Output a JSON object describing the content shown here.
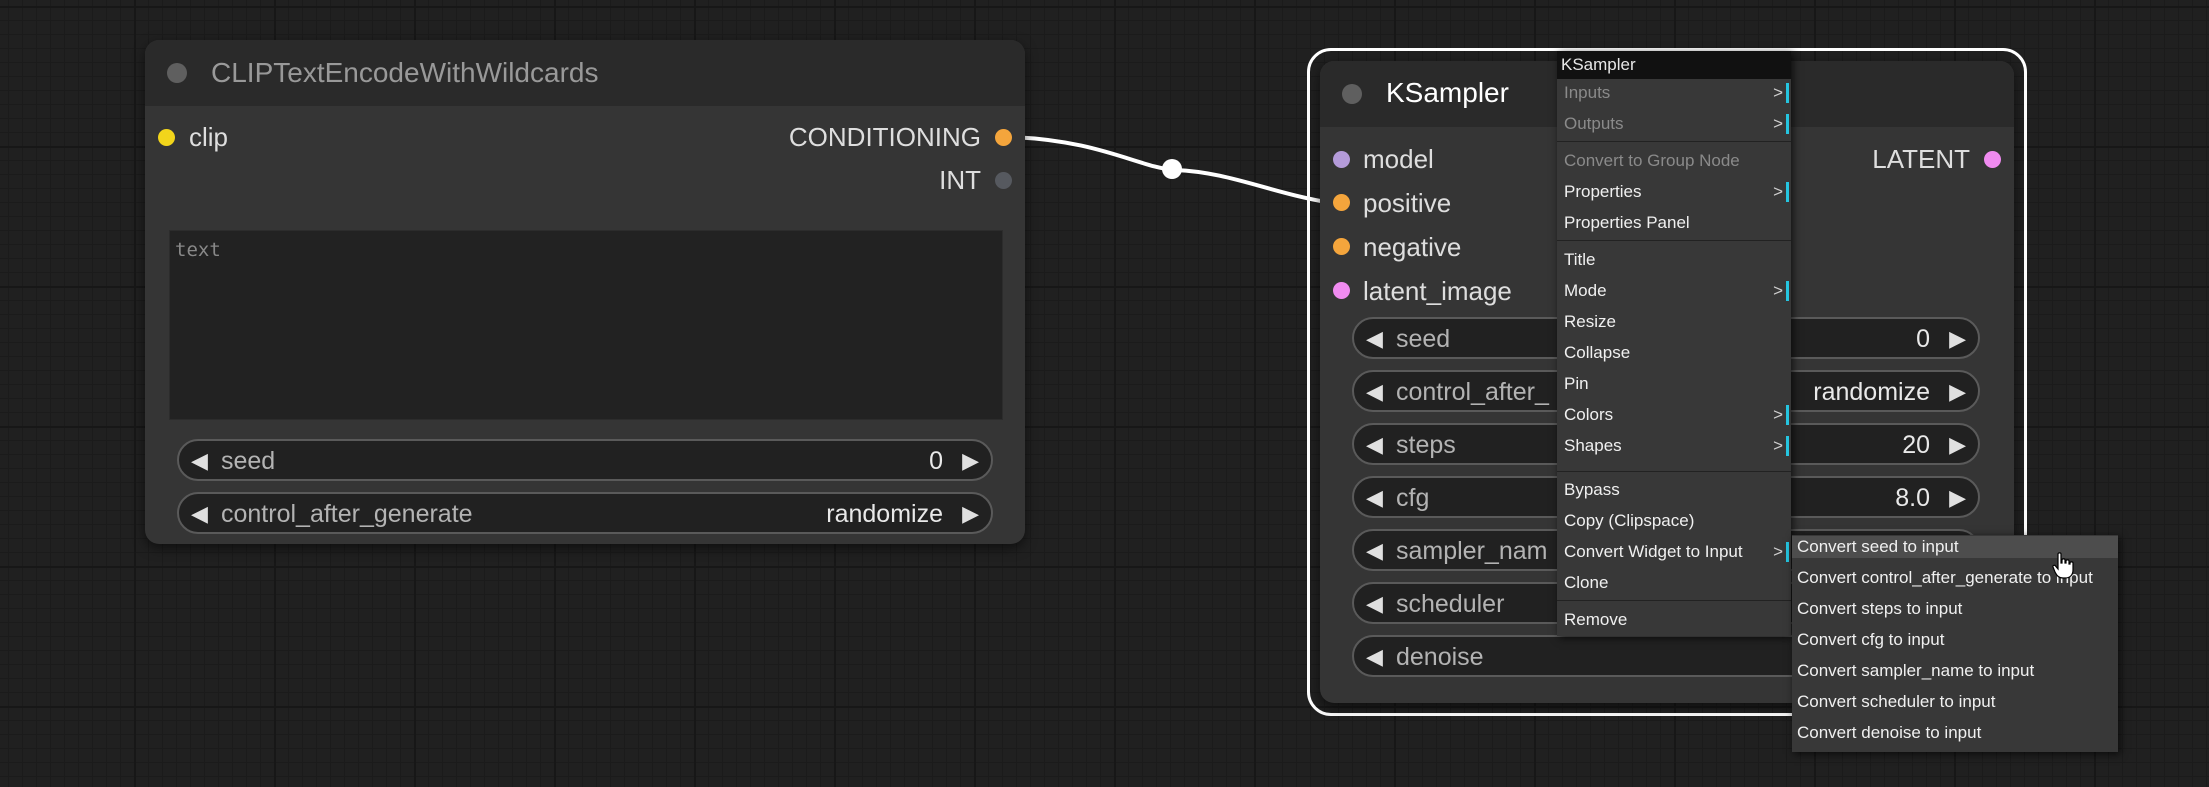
{
  "node_left": {
    "title": "CLIPTextEncodeWithWildcards",
    "inputs": [
      {
        "label": "clip",
        "color": "#f2d51b"
      }
    ],
    "outputs": [
      {
        "label": "CONDITIONING",
        "color": "#f4a53c"
      },
      {
        "label": "INT",
        "color": "#56595f"
      }
    ],
    "text_placeholder": "text",
    "widgets": [
      {
        "label": "seed",
        "value": "0"
      },
      {
        "label": "control_after_generate",
        "value": "randomize"
      }
    ]
  },
  "node_ksampler": {
    "title": "KSampler",
    "inputs": [
      {
        "label": "model",
        "color": "#b49bd9"
      },
      {
        "label": "positive",
        "color": "#f4a53c"
      },
      {
        "label": "negative",
        "color": "#f4a53c"
      },
      {
        "label": "latent_image",
        "color": "#f08bf0"
      }
    ],
    "outputs": [
      {
        "label": "LATENT",
        "color": "#f08bf0"
      }
    ],
    "widgets": [
      {
        "label": "seed",
        "value": "0"
      },
      {
        "label": "control_after_",
        "value": "randomize"
      },
      {
        "label": "steps",
        "value": "20"
      },
      {
        "label": "cfg",
        "value": "8.0"
      },
      {
        "label": "sampler_nam",
        "value": ""
      },
      {
        "label": "scheduler",
        "value": ""
      },
      {
        "label": "denoise",
        "value": ""
      }
    ]
  },
  "context_menu": {
    "title": "KSampler",
    "items": [
      {
        "label": "Inputs",
        "disabled": true,
        "submenu": true
      },
      {
        "label": "Outputs",
        "disabled": true,
        "submenu": true
      },
      {
        "label": "Convert to Group Node",
        "disabled": true
      },
      {
        "label": "Properties",
        "submenu": true
      },
      {
        "label": "Properties Panel"
      },
      {
        "label": "Title"
      },
      {
        "label": "Mode",
        "submenu": true
      },
      {
        "label": "Resize"
      },
      {
        "label": "Collapse"
      },
      {
        "label": "Pin"
      },
      {
        "label": "Colors",
        "submenu": true
      },
      {
        "label": "Shapes",
        "submenu": true
      },
      {
        "label": "Bypass"
      },
      {
        "label": "Copy (Clipspace)"
      },
      {
        "label": "Convert Widget to Input",
        "submenu": true
      },
      {
        "label": "Clone"
      },
      {
        "label": "Remove"
      }
    ],
    "submenu_arrow": ">"
  },
  "submenu": {
    "items": [
      {
        "label": "Convert seed to input",
        "highlighted": true
      },
      {
        "label": "Convert control_after_generate to input"
      },
      {
        "label": "Convert steps to input"
      },
      {
        "label": "Convert cfg to input"
      },
      {
        "label": "Convert sampler_name to input"
      },
      {
        "label": "Convert scheduler to input"
      },
      {
        "label": "Convert denoise to input"
      }
    ]
  },
  "icons": {
    "arrow_left": "◀",
    "arrow_right": "▶",
    "cursor": "hand-pointer-icon"
  },
  "colors": {
    "canvas_bg": "#202020",
    "node_bg": "#353535",
    "selection_outline": "#ffffff",
    "link": "#ffffff",
    "submenu_accent": "#25c5e0"
  }
}
